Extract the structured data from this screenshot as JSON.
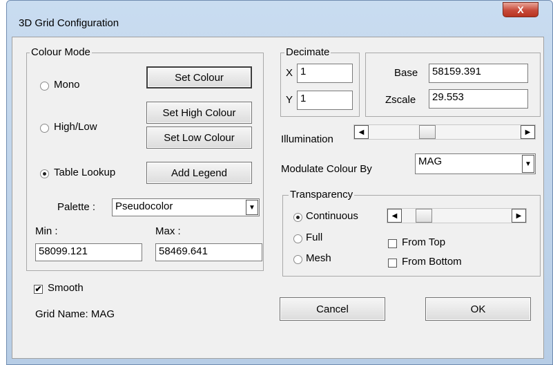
{
  "window": {
    "title": "3D Grid Configuration",
    "close_glyph": "X"
  },
  "colour_mode": {
    "label": "Colour Mode",
    "mono_label": "Mono",
    "highlow_label": "High/Low",
    "table_lookup_label": "Table Lookup",
    "selected": "Table Lookup",
    "set_colour": "Set Colour",
    "set_high_colour": "Set High Colour",
    "set_low_colour": "Set Low Colour",
    "add_legend": "Add Legend",
    "palette_label": "Palette :",
    "palette_value": "Pseudocolor",
    "min_label": "Min :",
    "min_value": "58099.121",
    "max_label": "Max :",
    "max_value": "58469.641"
  },
  "decimate": {
    "label": "Decimate",
    "x_label": "X",
    "x_value": "1",
    "y_label": "Y",
    "y_value": "1"
  },
  "base": {
    "base_label": "Base",
    "base_value": "58159.391",
    "zscale_label": "Zscale",
    "zscale_value": "29.553"
  },
  "illumination": {
    "label": "Illumination",
    "level_fraction": 0.37
  },
  "modulate": {
    "label": "Modulate Colour By",
    "value": "MAG"
  },
  "transparency": {
    "label": "Transparency",
    "continuous_label": "Continuous",
    "full_label": "Full",
    "mesh_label": "Mesh",
    "selected": "Continuous",
    "slider_fraction": 0.15,
    "from_top_label": "From Top",
    "from_bottom_label": "From Bottom",
    "from_top_checked": false,
    "from_bottom_checked": false
  },
  "smooth": {
    "label": "Smooth",
    "checked": true
  },
  "grid_name": "Grid Name: MAG",
  "buttons": {
    "cancel": "Cancel",
    "ok": "OK"
  },
  "glyphs": {
    "left": "◀",
    "right": "▶",
    "down": "▼",
    "check": "✔"
  }
}
